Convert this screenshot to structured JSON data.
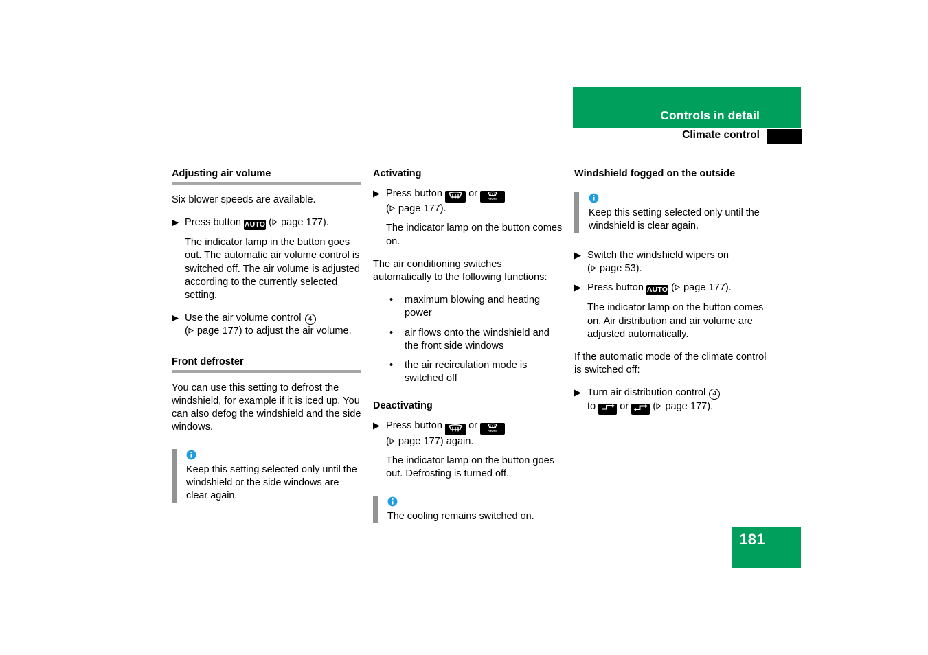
{
  "header": {
    "chapter_title": "Controls in detail",
    "section_title": "Climate control",
    "green": "#00A05C",
    "tab_color": "#000000"
  },
  "page_number": "181",
  "columns": {
    "left": {
      "sections": [
        {
          "heading": "Adjusting air volume",
          "intro": "Six blower speeds are available.",
          "step1_pre": "Press button",
          "step1_btn": "AUTO",
          "step1_post_open": "(",
          "step1_post": " page 177).",
          "step1_result": "The indicator lamp in the button goes out. The automatic air volume control is switched off. The air volume is adjusted according to the currently selected setting.",
          "step2_pre": "Use the air volume control",
          "step2_circled": "4",
          "step2_post": " page 177) to adjust the air volume."
        },
        {
          "heading": "Front defroster",
          "intro": "You can use this setting to defrost the windshield, for example if it is iced up. You can also defog the windshield and the side windows.",
          "note": "Keep this setting selected only until the windshield or the side windows are clear again."
        }
      ]
    },
    "middle": {
      "sections": [
        {
          "heading": "Activating",
          "step1_pre": "Press button",
          "step1_btn_a": "rear-defrost-icon",
          "step1_or": "or",
          "step1_btn_b": "front-defrost-icon",
          "step1_post": " page 177).",
          "step1_result": "The indicator lamp on the button comes on.",
          "para": "The air conditioning switches automatically to the following functions:",
          "bullets": [
            "maximum blowing and heating power",
            "air flows onto the windshield and the front side windows",
            "the air recirculation mode is switched off"
          ]
        },
        {
          "heading": "Deactivating",
          "step1_pre": "Press button",
          "step1_or": "or",
          "step1_post": " page 177) again.",
          "step1_result": "The indicator lamp on the button goes out. Defrosting is turned off.",
          "note": "The cooling remains switched on."
        }
      ]
    },
    "right": {
      "sections": [
        {
          "heading": "Windshield fogged on the outside",
          "note": "Keep this setting selected only until the windshield is clear again.",
          "step1_pre": "Switch the windshield wipers on",
          "step1_post": " page 53).",
          "step2_pre": "Press button",
          "step2_btn": "AUTO",
          "step2_post": " page 177).",
          "step2_result": "The indicator lamp on the button comes on. Air distribution and air volume are adjusted automatically.",
          "para": "If the automatic mode of the climate control is switched off:",
          "step3_pre": "Turn air distribution control",
          "step3_circled": "4",
          "step3_to": "to",
          "step3_or": "or",
          "step3_post": " page 177)."
        }
      ]
    }
  }
}
